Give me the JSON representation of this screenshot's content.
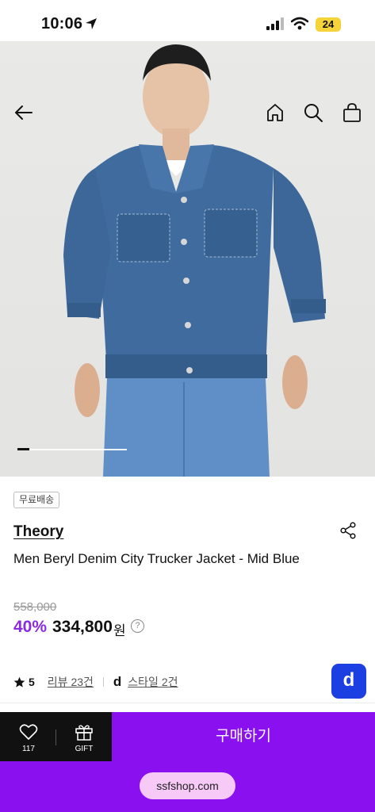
{
  "status": {
    "time": "10:06",
    "battery": "24"
  },
  "product": {
    "free_shipping_badge": "무료배송",
    "brand": "Theory",
    "name": "Men Beryl Denim City Trucker Jacket - Mid Blue",
    "original_price": "558,000",
    "discount": "40%",
    "price": "334,800",
    "currency": "원",
    "help_mark": "?",
    "image_pager": {
      "current": 1
    }
  },
  "meta": {
    "rating": "5",
    "review_link": "리뷰 23건",
    "style_icon": "d",
    "style_link": "스타일 2건",
    "fab_icon": "d"
  },
  "bottom": {
    "wish_count": "117",
    "gift_label": "GIFT",
    "buy_label": "구매하기",
    "url": "ssfshop.com"
  },
  "colors": {
    "accent": "#8b10f0",
    "discount": "#8a2be2",
    "fab": "#1b3fe0",
    "denim": "#3f6b9f"
  }
}
